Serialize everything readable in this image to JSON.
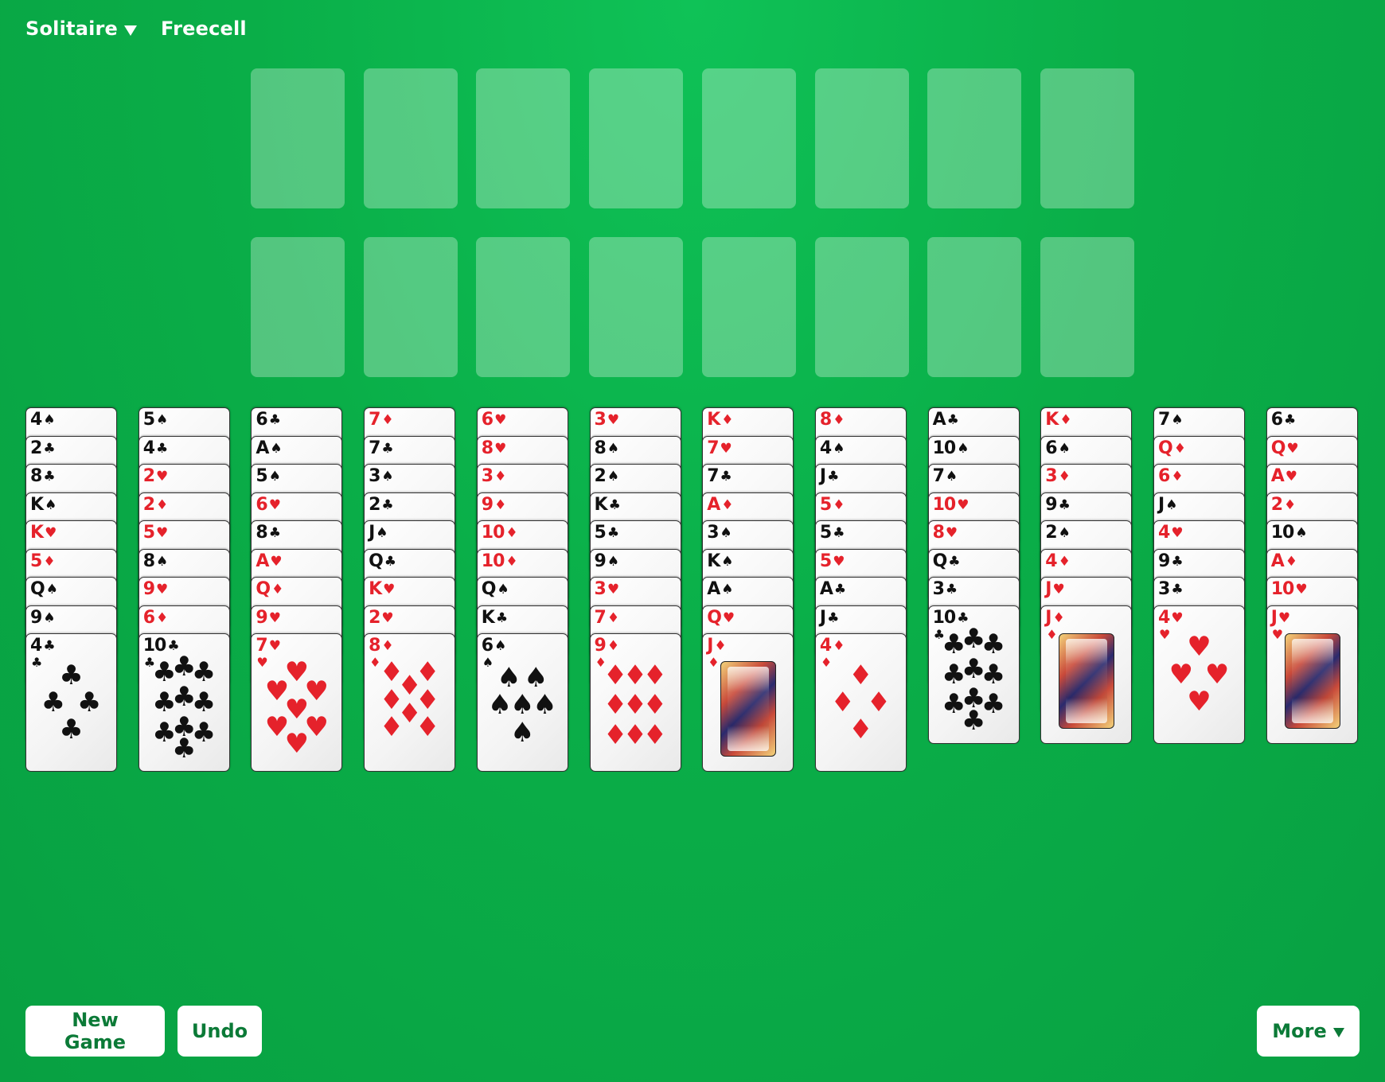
{
  "nav": {
    "solitaire_label": "Solitaire",
    "freecell_label": "Freecell"
  },
  "colors": {
    "felt": "#0aae48",
    "red_suit": "#e5222b",
    "black_suit": "#111111",
    "button_text": "#0b7a37"
  },
  "free_cells": {
    "count": 8,
    "cards": []
  },
  "foundations": {
    "count": 8,
    "cards": []
  },
  "tableau": [
    [
      "4♠",
      "2♣",
      "8♣",
      "K♠",
      "K♥",
      "5♦",
      "Q♠",
      "9♠",
      "4♣"
    ],
    [
      "5♠",
      "4♣",
      "2♥",
      "2♦",
      "5♥",
      "8♠",
      "9♥",
      "6♦",
      "10♣"
    ],
    [
      "6♣",
      "A♠",
      "5♠",
      "6♥",
      "8♣",
      "A♥",
      "Q♦",
      "9♥",
      "7♥"
    ],
    [
      "7♦",
      "7♣",
      "3♠",
      "2♣",
      "J♠",
      "Q♣",
      "K♥",
      "2♥",
      "8♦"
    ],
    [
      "6♥",
      "8♥",
      "3♦",
      "9♦",
      "10♦",
      "10♦",
      "Q♠",
      "K♣",
      "6♠"
    ],
    [
      "3♥",
      "8♠",
      "2♠",
      "K♣",
      "5♣",
      "9♠",
      "3♥",
      "7♦",
      "9♦"
    ],
    [
      "K♦",
      "7♥",
      "7♣",
      "A♦",
      "3♠",
      "K♠",
      "A♠",
      "Q♥",
      "J♦"
    ],
    [
      "8♦",
      "4♠",
      "J♣",
      "5♦",
      "5♣",
      "5♥",
      "A♣",
      "J♣",
      "4♦"
    ],
    [
      "A♣",
      "10♠",
      "7♠",
      "10♥",
      "8♥",
      "Q♣",
      "3♣",
      "10♣"
    ],
    [
      "K♦",
      "6♠",
      "3♦",
      "9♣",
      "2♠",
      "4♦",
      "J♥",
      "J♦"
    ],
    [
      "7♠",
      "Q♦",
      "6♦",
      "J♠",
      "4♥",
      "9♣",
      "3♣",
      "4♥"
    ],
    [
      "6♣",
      "Q♥",
      "A♥",
      "2♦",
      "10♠",
      "A♦",
      "10♥",
      "J♥"
    ]
  ],
  "buttons": {
    "new_game": "New Game",
    "undo": "Undo",
    "more": "More"
  }
}
